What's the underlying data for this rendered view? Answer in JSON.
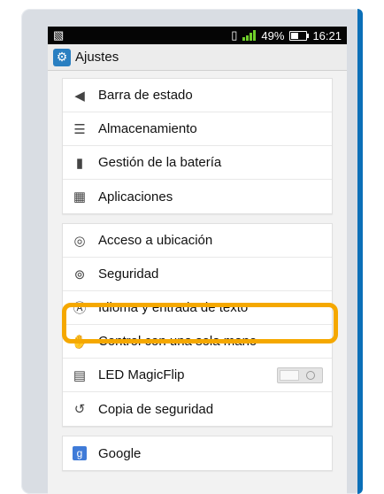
{
  "status_bar": {
    "battery_percent": "49%",
    "time": "16:21"
  },
  "app_bar": {
    "title": "Ajustes"
  },
  "group1": {
    "items": [
      {
        "label": "Barra de estado"
      },
      {
        "label": "Almacenamiento"
      },
      {
        "label": "Gestión de la batería"
      },
      {
        "label": "Aplicaciones"
      }
    ]
  },
  "group2": {
    "items": [
      {
        "label": "Acceso a ubicación"
      },
      {
        "label": "Seguridad"
      },
      {
        "label": "Idioma y entrada de texto"
      },
      {
        "label": "Control con una sola mano"
      },
      {
        "label": "LED MagicFlip"
      },
      {
        "label": "Copia de seguridad"
      }
    ]
  },
  "group3": {
    "items": [
      {
        "label": "Google"
      }
    ]
  },
  "colors": {
    "highlight": "#f5a800",
    "accent": "#0a6fb8"
  }
}
